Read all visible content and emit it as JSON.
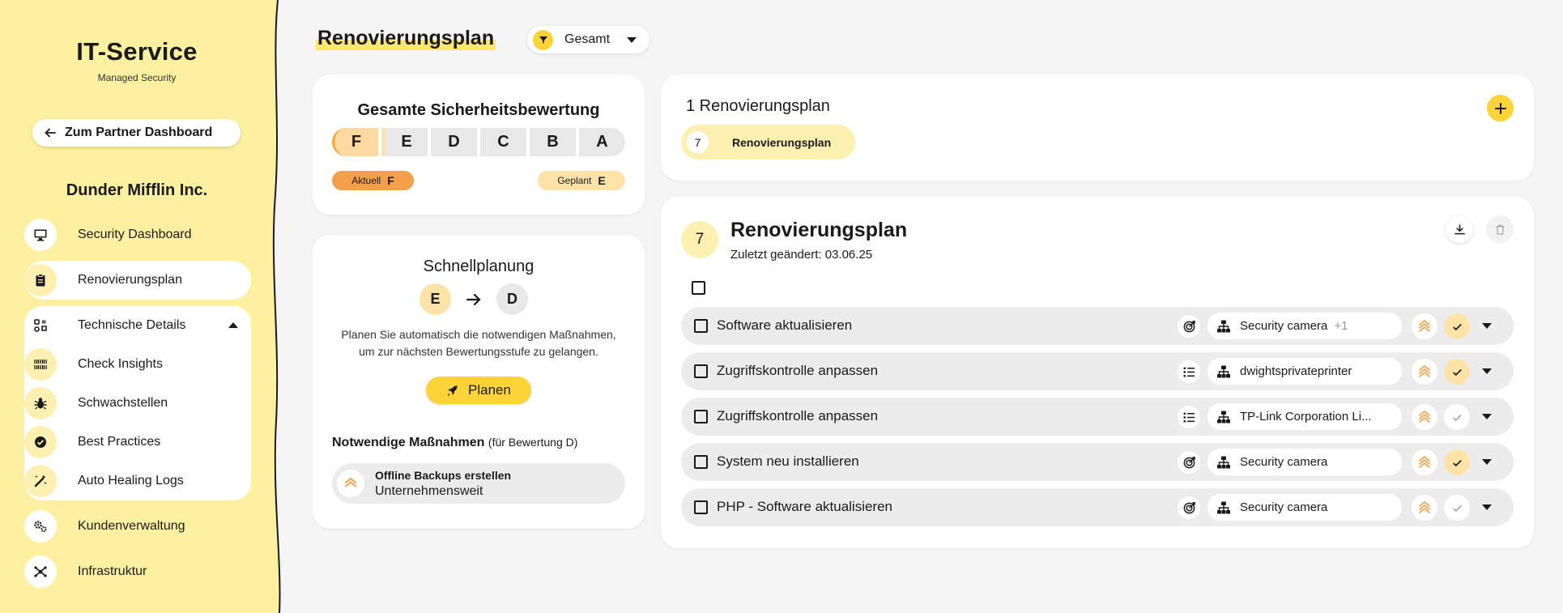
{
  "sidebar": {
    "brand": "IT-Service",
    "brand_sub": "Managed Security",
    "partner_button": "Zum Partner Dashboard",
    "company": "Dunder Mifflin Inc.",
    "items": [
      {
        "label": "Security Dashboard",
        "icon": "monitor-icon"
      },
      {
        "label": "Renovierungsplan",
        "icon": "clipboard-icon"
      },
      {
        "label": "Technische Details",
        "icon": "details-icon"
      },
      {
        "label": "Check Insights",
        "icon": "barcode-icon"
      },
      {
        "label": "Schwachstellen",
        "icon": "bug-icon"
      },
      {
        "label": "Best Practices",
        "icon": "badge-check-icon"
      },
      {
        "label": "Auto Healing Logs",
        "icon": "magic-wand-icon"
      },
      {
        "label": "Kundenverwaltung",
        "icon": "gears-icon"
      },
      {
        "label": "Infrastruktur",
        "icon": "network-icon"
      }
    ]
  },
  "header": {
    "title": "Renovierungsplan",
    "filter_label": "Gesamt"
  },
  "rating": {
    "title": "Gesamte Sicherheitsbewertung",
    "grades": [
      "F",
      "E",
      "D",
      "C",
      "B",
      "A"
    ],
    "current_label": "Aktuell",
    "current_grade": "F",
    "planned_label": "Geplant",
    "planned_grade": "E"
  },
  "quick": {
    "title": "Schnellplanung",
    "from": "E",
    "to": "D",
    "description": "Planen Sie automatisch die notwendigen Maßnahmen, um zur nächsten Bewertungsstufe zu gelangen.",
    "button": "Planen",
    "measures_heading": "Notwendige Maßnahmen",
    "measures_note": "(für Bewertung D)",
    "measure_title": "Offline Backups erstellen",
    "measure_scope": "Unternehmensweit"
  },
  "plans": {
    "title": "1 Renovierungsplan",
    "chip_number": "7",
    "chip_label": "Renovierungsplan"
  },
  "detail": {
    "number": "7",
    "title": "Renovierungsplan",
    "subtitle": "Zuletzt geändert: 03.06.25",
    "tasks": [
      {
        "title": "Software aktualisieren",
        "type_icon": "target-icon",
        "asset": "Security camera",
        "asset_extra": "+1",
        "done": true
      },
      {
        "title": "Zugriffskontrolle anpassen",
        "type_icon": "list-icon",
        "asset": "dwightsprivateprinter",
        "asset_extra": "",
        "done": true
      },
      {
        "title": "Zugriffskontrolle anpassen",
        "type_icon": "list-icon",
        "asset": "TP-Link Corporation Li...",
        "asset_extra": "",
        "done": false
      },
      {
        "title": "System neu installieren",
        "type_icon": "target-icon",
        "asset": "Security camera",
        "asset_extra": "",
        "done": true
      },
      {
        "title": "PHP - Software aktualisieren",
        "type_icon": "target-icon",
        "asset": "Security camera",
        "asset_extra": "",
        "done": false
      }
    ]
  },
  "colors": {
    "sidebar_bg": "#fdf0a0",
    "accent": "#fdd33a",
    "orange": "#f4a04b",
    "light_orange": "#fde3a8",
    "row_bg": "#ececec"
  }
}
